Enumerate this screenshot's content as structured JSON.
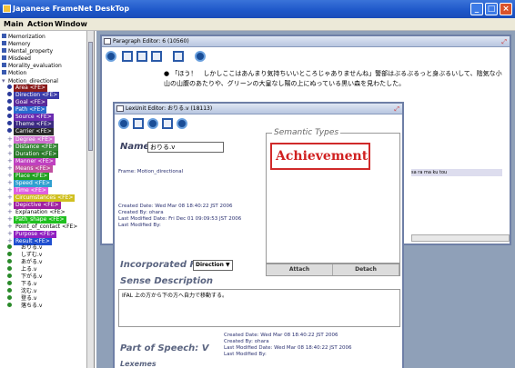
{
  "app": {
    "title": "Japanese FrameNet DeskTop"
  },
  "window_controls": {
    "minimize": "_",
    "maximize": "□",
    "close": "×"
  },
  "menu": [
    "Main",
    "Action",
    "Window"
  ],
  "tree": {
    "items": [
      {
        "label": "Memorization",
        "kind": "sq"
      },
      {
        "label": "Memory",
        "kind": "sq"
      },
      {
        "label": "Mental_property",
        "kind": "sq"
      },
      {
        "label": "Misdeed",
        "kind": "sq"
      },
      {
        "label": "Morality_evaluation",
        "kind": "sq"
      },
      {
        "label": "Motion",
        "kind": "sq"
      },
      {
        "label": "Motion_directional",
        "kind": "open"
      }
    ],
    "fes": [
      {
        "label": "Area <FE>",
        "color": "#8a1a1a"
      },
      {
        "label": "Direction <FE>",
        "color": "#3a3aa8"
      },
      {
        "label": "Goal <FE>",
        "color": "#5a2a9a"
      },
      {
        "label": "Path <FE>",
        "color": "#2a6ad0"
      },
      {
        "label": "Source <FE>",
        "color": "#6a2ab0"
      },
      {
        "label": "Theme <FE>",
        "color": "#3a2a80"
      },
      {
        "label": "Carrier <FE>",
        "color": "#2a2a2a"
      },
      {
        "label": "Degree <FE>",
        "color": "#d070d0"
      },
      {
        "label": "Distance <FE>",
        "color": "#3a8a3a"
      },
      {
        "label": "Duration <FE>",
        "color": "#2a7a2a"
      },
      {
        "label": "Manner <FE>",
        "color": "#c040c0"
      },
      {
        "label": "Means <FE>",
        "color": "#c050a0"
      },
      {
        "label": "Place <FE>",
        "color": "#20a020"
      },
      {
        "label": "Speed <FE>",
        "color": "#30a0d0"
      },
      {
        "label": "Time <FE>",
        "color": "#e060e0"
      },
      {
        "label": "Circumstances <FE>",
        "color": "#d0c020"
      },
      {
        "label": "Depictive <FE>",
        "color": "#a020a0"
      },
      {
        "label": "Explanation <FE>",
        "color": ""
      },
      {
        "label": "Path_shape <FE>",
        "color": "#20c020"
      },
      {
        "label": "Point_of_contact <FE>",
        "color": ""
      },
      {
        "label": "Purpose <FE>",
        "color": "#9020c0"
      },
      {
        "label": "Result <FE>",
        "color": "#2050d0"
      }
    ],
    "lus": [
      "おりる.v",
      "しずむ.v",
      "あがる.v",
      "上る.v",
      "下がる.v",
      "下る.v",
      "沈む.v",
      "登る.v",
      "落ちる.v"
    ]
  },
  "paragraph_editor": {
    "title": "Paragraph Editor: 6 (10560)",
    "sentence": "「ほう！　しかしここはあんまり気持ちいいところじゃありませんね」警部はぶるぶるっと身ぶるいして、陰気な小山の山腹のあたりや、グリーンの大皇なし陽の上にぬっている黒い森を見わたした。",
    "frame_row": "sa ra ma ku tou"
  },
  "lu_editor": {
    "title": "LexUnit Editor: おりる.v (18113)",
    "name_label": "Name",
    "name_value": "おりる.v",
    "frame": "Frame: Motion_directional",
    "created_date": "Created Date: Wed Mar 08 18:40:22 JST 2006",
    "created_by": "Created By: ohara",
    "last_modified_date": "Last Modified Date: Fri Dec 01 09:09:53 JST 2006",
    "last_modified_by": "Last Modified By:",
    "semantic_types_label": "Semantic Types",
    "semantic_type": "Achievement",
    "attach_button": "Attach",
    "detach_button": "Detach",
    "incorporated_fe_label": "Incorporated FE",
    "incorporated_fe_value": "Direction",
    "sense_description_label": "Sense Description",
    "sense_description": "IFAL 上の方から下の方へ自力で移動する。",
    "pos_label": "Part of Speech: V",
    "pos_created_date": "Created Date: Wed Mar 08 18:40:22 JST 2006",
    "pos_created_by": "Created By: ohara",
    "pos_last_modified_date": "Last Modified Date: Wed Mar 08 18:40:22 JST 2006",
    "pos_last_modified_by": "Last Modified By:",
    "lexemes_label": "Lexemes"
  }
}
